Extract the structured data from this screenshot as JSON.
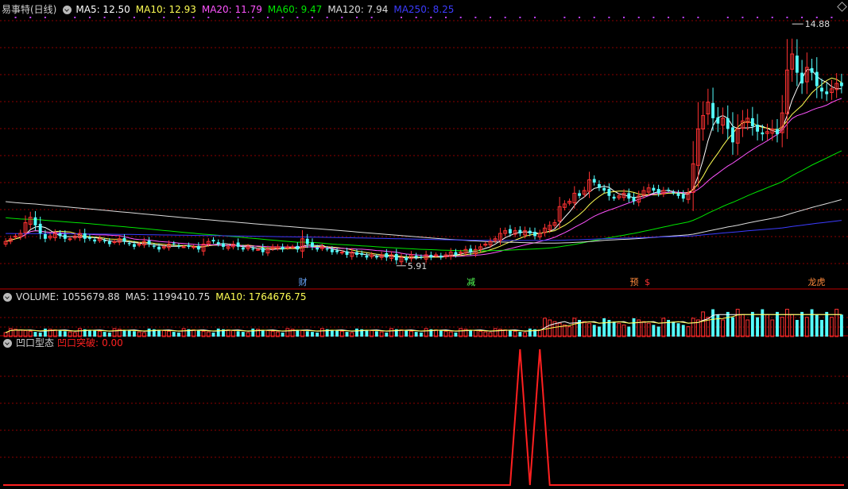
{
  "colors": {
    "up": "#ff3232",
    "down": "#54ffff",
    "bg": "#000000",
    "grid": "#8b0000",
    "ma5": "#ffffff",
    "ma10": "#ffff54",
    "ma20": "#ff54ff",
    "ma60": "#00e600",
    "ma120": "#dcdcdc",
    "ma250": "#3c3cff",
    "signal": "#ff2020"
  },
  "price_panel": {
    "title": "易事特(日线)",
    "indicators": [
      {
        "label": "MA5:",
        "value": "12.50",
        "color": "#ffffff"
      },
      {
        "label": "MA10:",
        "value": "12.93",
        "color": "#ffff54"
      },
      {
        "label": "MA20:",
        "value": "11.79",
        "color": "#ff54ff"
      },
      {
        "label": "MA60:",
        "value": "9.47",
        "color": "#00e600"
      },
      {
        "label": "MA120:",
        "value": "7.94",
        "color": "#dcdcdc"
      },
      {
        "label": "MA250:",
        "value": "8.25",
        "color": "#3c3cff"
      }
    ],
    "high_label": "14.88",
    "low_label": "5.91",
    "events": [
      {
        "text": "财",
        "color": "#6aa8ff",
        "index": 60
      },
      {
        "text": "减",
        "color": "#54ff54",
        "index": 94
      },
      {
        "text": "预",
        "color": "#ff8a3c",
        "index": 127
      },
      {
        "text": "$",
        "color": "#ff3232",
        "index": 130
      },
      {
        "text": "龙虎",
        "color": "#ff8a3c",
        "index": 163
      }
    ]
  },
  "volume_panel": {
    "indicators": [
      {
        "label": "VOLUME:",
        "value": "1055679.88",
        "color": "#dcdcdc"
      },
      {
        "label": "MA5:",
        "value": "1199410.75",
        "color": "#dcdcdc"
      },
      {
        "label": "MA10:",
        "value": "1764676.75",
        "color": "#ffff54"
      }
    ]
  },
  "signal_panel": {
    "title": "凹口型态",
    "indicator_label": "凹口突破:",
    "indicator_value": "0.00"
  },
  "chart_data": {
    "type": "candlestick",
    "series_name": "易事特(日线)",
    "ylim": [
      5.4,
      15.3
    ],
    "high": 14.88,
    "low": 5.91,
    "closes": [
      6.7,
      6.8,
      6.9,
      7.0,
      7.4,
      7.6,
      7.3,
      7.0,
      6.8,
      6.9,
      7.0,
      6.9,
      6.8,
      6.8,
      6.9,
      7.0,
      6.8,
      6.8,
      6.7,
      6.8,
      6.7,
      6.6,
      6.7,
      6.8,
      6.7,
      6.6,
      6.5,
      6.6,
      6.7,
      6.6,
      6.5,
      6.4,
      6.5,
      6.6,
      6.6,
      6.5,
      6.5,
      6.5,
      6.5,
      6.4,
      6.6,
      6.7,
      6.7,
      6.6,
      6.5,
      6.5,
      6.6,
      6.5,
      6.4,
      6.5,
      6.4,
      6.4,
      6.3,
      6.4,
      6.5,
      6.5,
      6.4,
      6.5,
      6.5,
      6.4,
      6.8,
      6.6,
      6.5,
      6.4,
      6.5,
      6.4,
      6.3,
      6.3,
      6.3,
      6.2,
      6.3,
      6.2,
      6.2,
      6.1,
      6.2,
      6.1,
      6.2,
      6.1,
      6.2,
      6.0,
      6.1,
      6.0,
      6.2,
      6.1,
      6.1,
      6.2,
      6.1,
      6.2,
      6.1,
      6.2,
      6.3,
      6.2,
      6.3,
      6.4,
      6.3,
      6.4,
      6.5,
      6.6,
      6.7,
      6.8,
      7.0,
      7.1,
      7.0,
      7.1,
      7.0,
      7.1,
      7.0,
      6.9,
      7.0,
      7.2,
      7.3,
      7.4,
      8.0,
      8.1,
      8.2,
      8.5,
      8.4,
      8.6,
      9.0,
      8.9,
      8.7,
      8.6,
      8.4,
      8.3,
      8.4,
      8.5,
      8.3,
      8.2,
      8.4,
      8.6,
      8.7,
      8.6,
      8.5,
      8.6,
      8.6,
      8.5,
      8.4,
      8.3,
      8.5,
      9.6,
      10.9,
      11.4,
      11.9,
      11.3,
      11.1,
      11.3,
      10.9,
      10.4,
      10.9,
      11.2,
      11.3,
      11.0,
      10.8,
      10.7,
      10.8,
      10.9,
      10.7,
      11.5,
      13.1,
      13.7,
      13.0,
      12.6,
      13.2,
      13.0,
      12.5,
      12.3,
      12.2,
      12.4,
      12.6,
      12.5
    ]
  }
}
